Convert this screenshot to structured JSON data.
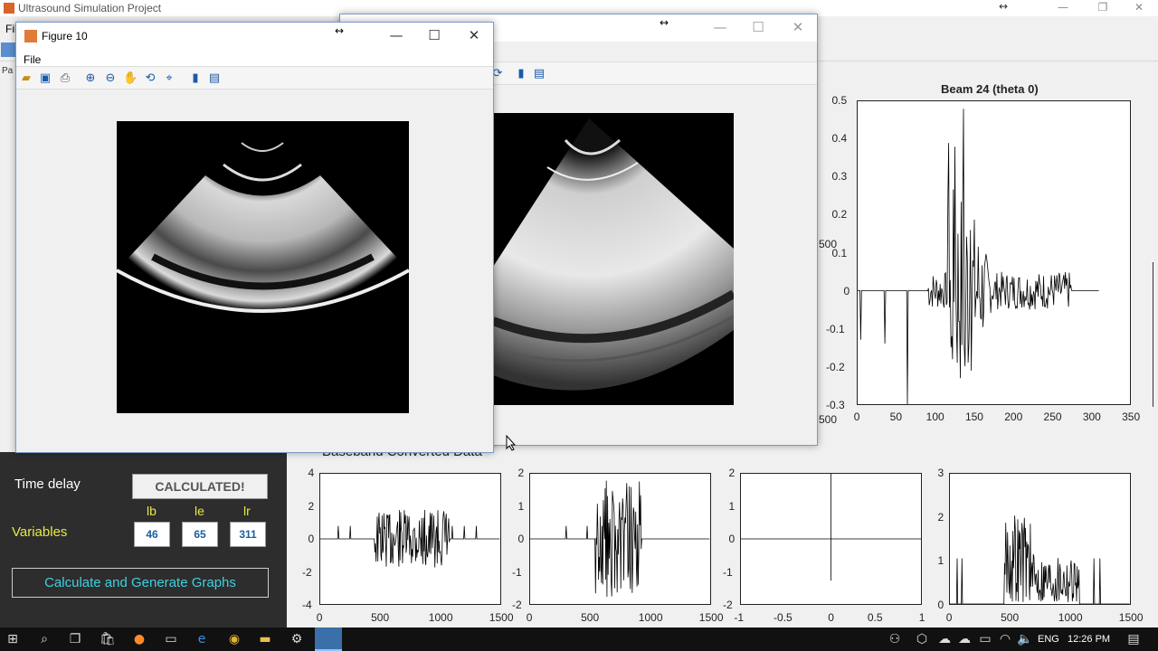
{
  "main_window": {
    "title": "Ultrasound Simulation Project",
    "menu_file": "File",
    "partial_label": "Pa"
  },
  "figure10": {
    "title": "Figure 10",
    "menu_file": "File"
  },
  "figure_back": {
    "title": ""
  },
  "beam_plot": {
    "title": "Beam 24 (theta 0)",
    "y_ticks": [
      "0.5",
      "0.4",
      "0.3",
      "0.2",
      "0.1",
      "0",
      "-0.1",
      "-0.2",
      "-0.3"
    ],
    "x_ticks": [
      "0",
      "50",
      "100",
      "150",
      "200",
      "250",
      "300",
      "350"
    ]
  },
  "partial_axis_labels": {
    "top": "500",
    "bottom": "500"
  },
  "baseband": {
    "title": "Baseband Converted Data",
    "plots": [
      {
        "y_ticks": [
          "4",
          "2",
          "0",
          "-2",
          "-4"
        ],
        "x_ticks": [
          "0",
          "500",
          "1000",
          "1500"
        ]
      },
      {
        "y_ticks": [
          "2",
          "1",
          "0",
          "-1",
          "-2"
        ],
        "x_ticks": [
          "0",
          "500",
          "1000",
          "1500"
        ]
      },
      {
        "y_ticks": [
          "2",
          "1",
          "0",
          "-1",
          "-2"
        ],
        "x_ticks": [
          "-1",
          "-0.5",
          "0",
          "0.5",
          "1"
        ]
      },
      {
        "y_ticks": [
          "3",
          "2",
          "1",
          "0"
        ],
        "x_ticks": [
          "0",
          "500",
          "1000",
          "1500"
        ]
      }
    ]
  },
  "controls": {
    "time_delay_label": "Time delay",
    "time_delay_status": "CALCULATED!",
    "variables_label": "Variables",
    "var_headers": [
      "lb",
      "le",
      "lr"
    ],
    "var_values": [
      "46",
      "65",
      "311"
    ],
    "calc_button": "Calculate and Generate Graphs"
  },
  "taskbar": {
    "language": "ENG",
    "time": "12:26 PM"
  },
  "colors": {
    "panel_dark": "#2d2d2d",
    "variable_label": "#e8e84a",
    "calc_button_text": "#3fd0e0",
    "value_text": "#1a5fa0"
  }
}
